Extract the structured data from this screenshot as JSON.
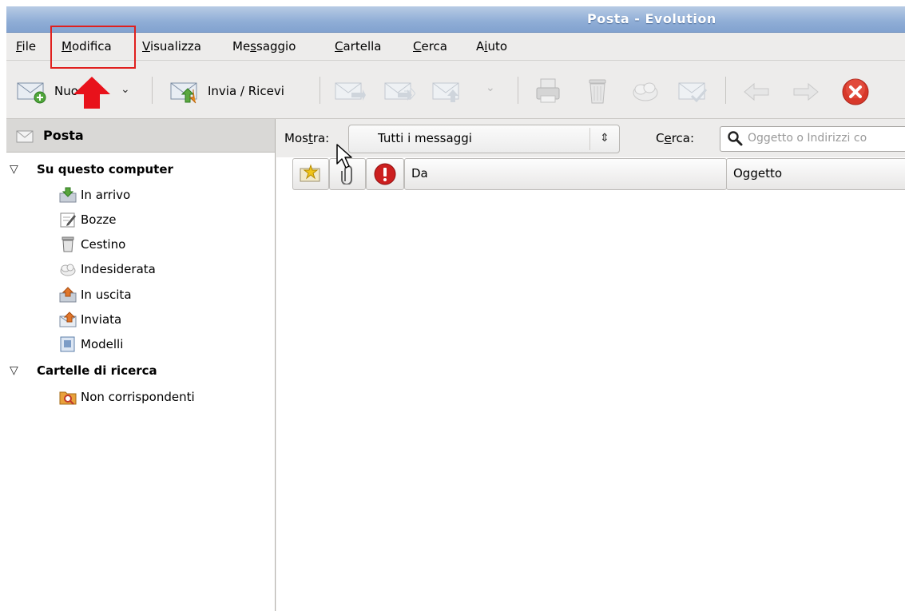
{
  "window": {
    "title": "Posta - Evolution"
  },
  "menu": [
    {
      "pre": "",
      "mn": "F",
      "post": "ile"
    },
    {
      "pre": "",
      "mn": "M",
      "post": "odifica"
    },
    {
      "pre": "",
      "mn": "V",
      "post": "isualizza"
    },
    {
      "pre": "Me",
      "mn": "s",
      "post": "saggio"
    },
    {
      "pre": "",
      "mn": "C",
      "post": "artella"
    },
    {
      "pre": "",
      "mn": "C",
      "post": "erca"
    },
    {
      "pre": "A",
      "mn": "i",
      "post": "uto"
    }
  ],
  "toolbar": {
    "new_label": "Nuo",
    "send_receive_label": "Invia / Ricevi",
    "icons": [
      "new-message-icon",
      "send-receive-icon",
      "reply-icon",
      "reply-all-icon",
      "forward-icon",
      "print-icon",
      "trash-icon",
      "junk-icon",
      "not-junk-icon",
      "back-arrow-icon",
      "forward-arrow-icon",
      "stop-icon"
    ]
  },
  "sidebar": {
    "header": "Posta",
    "groups": [
      {
        "label": "Su questo computer",
        "items": [
          {
            "label": "In arrivo",
            "icon": "inbox-icon"
          },
          {
            "label": "Bozze",
            "icon": "drafts-icon"
          },
          {
            "label": "Cestino",
            "icon": "trash-icon"
          },
          {
            "label": "Indesiderata",
            "icon": "junk-icon"
          },
          {
            "label": "In uscita",
            "icon": "outbox-icon"
          },
          {
            "label": "Inviata",
            "icon": "sent-icon"
          },
          {
            "label": "Modelli",
            "icon": "templates-icon"
          }
        ]
      },
      {
        "label": "Cartelle di ricerca",
        "items": [
          {
            "label": "Non corrispondenti",
            "icon": "search-folder-icon"
          }
        ]
      }
    ]
  },
  "filter": {
    "show_label_pre": "Mos",
    "show_label_mn": "t",
    "show_label_post": "ra:",
    "show_value": "Tutti i messaggi",
    "search_label_pre": "C",
    "search_label_mn": "e",
    "search_label_post": "rca:",
    "search_placeholder": "Oggetto o Indirizzi co"
  },
  "columns": {
    "from": "Da",
    "subject": "Oggetto"
  },
  "colors": {
    "titlebar": "#8fadd6",
    "highlight_box": "#e0201e",
    "annotation_arrow": "#e8121b",
    "stop_button": "#d8382a"
  }
}
